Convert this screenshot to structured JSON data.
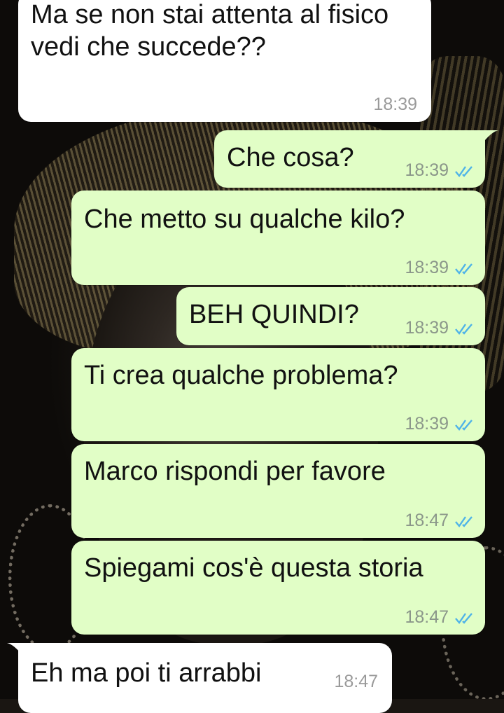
{
  "colors": {
    "incoming_bubble": "#ffffff",
    "outgoing_bubble": "#e1fec6",
    "timestamp_out": "#8b978a",
    "read_ticks": "#4fb3e8"
  },
  "messages": [
    {
      "direction": "incoming",
      "text": "Ma se non stai attenta al fisico vedi che succede??",
      "time": "18:39"
    },
    {
      "direction": "outgoing",
      "text": "Che cosa?",
      "time": "18:39",
      "status_icon": "double-check-read-icon"
    },
    {
      "direction": "outgoing",
      "text": "Che metto su qualche kilo?",
      "time": "18:39",
      "status_icon": "double-check-read-icon"
    },
    {
      "direction": "outgoing",
      "text": "BEH QUINDI?",
      "time": "18:39",
      "status_icon": "double-check-read-icon"
    },
    {
      "direction": "outgoing",
      "text": "Ti crea qualche problema?",
      "time": "18:39",
      "status_icon": "double-check-read-icon"
    },
    {
      "direction": "outgoing",
      "text": "Marco rispondi per favore",
      "time": "18:47",
      "status_icon": "double-check-read-icon"
    },
    {
      "direction": "outgoing",
      "text": "Spiegami cos'è questa storia",
      "time": "18:47",
      "status_icon": "double-check-read-icon"
    },
    {
      "direction": "incoming",
      "text": "Eh ma poi ti arrabbi",
      "time": "18:47"
    }
  ]
}
